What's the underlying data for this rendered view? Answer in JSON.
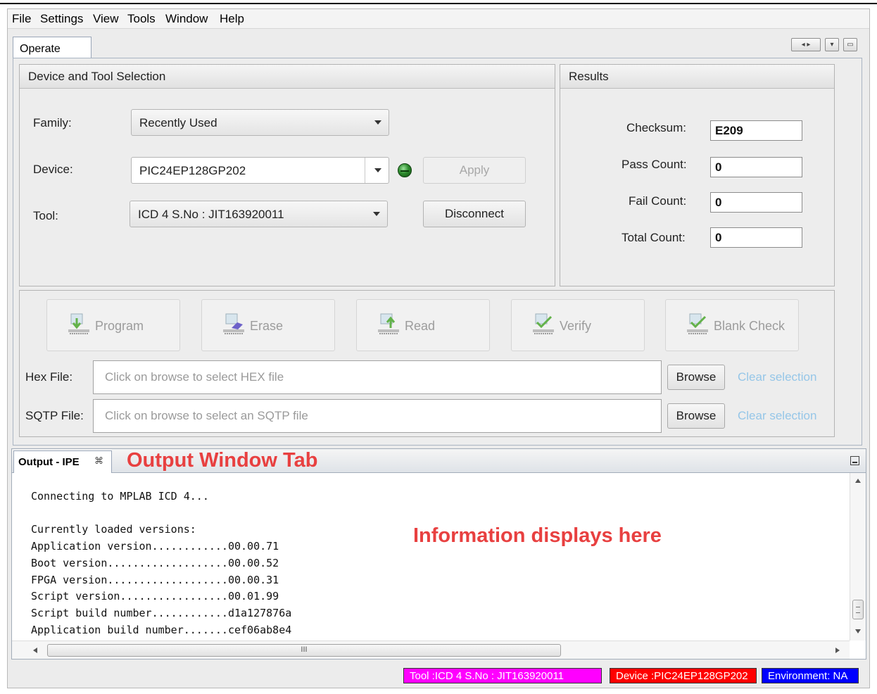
{
  "menu": [
    "File",
    "Settings",
    "View",
    "Tools",
    "Window",
    "Help"
  ],
  "tabs": {
    "operate": "Operate"
  },
  "device_tool": {
    "heading": "Device and Tool Selection",
    "family_label": "Family:",
    "family_value": "Recently Used",
    "device_label": "Device:",
    "device_value": "PIC24EP128GP202",
    "apply_label": "Apply",
    "tool_label": "Tool:",
    "tool_value": "ICD 4 S.No : JIT163920011",
    "disconnect_label": "Disconnect"
  },
  "results": {
    "heading": "Results",
    "checksum_label": "Checksum:",
    "checksum_value": "E209",
    "pass_label": "Pass Count:",
    "pass_value": "0",
    "fail_label": "Fail Count:",
    "fail_value": "0",
    "total_label": "Total Count:",
    "total_value": "0"
  },
  "actions": {
    "program": "Program",
    "erase": "Erase",
    "read": "Read",
    "verify": "Verify",
    "blank_check": "Blank Check"
  },
  "files": {
    "hex_label": "Hex File:",
    "hex_placeholder": "Click on browse to select HEX file",
    "sqtp_label": "SQTP File:",
    "sqtp_placeholder": "Click on browse to select an SQTP file",
    "browse_label": "Browse",
    "clear_label": "Clear selection"
  },
  "output": {
    "tab_label": "Output - IPE",
    "tab_close": "⌘",
    "annotation_tab": "Output Window Tab",
    "annotation_info": "Information displays here",
    "lines": [
      "Connecting to MPLAB ICD 4...",
      "",
      "Currently loaded versions:",
      "Application version............00.00.71",
      "Boot version...................00.00.52",
      "FPGA version...................00.00.31",
      "Script version.................00.01.99",
      "Script build number............d1a127876a",
      "Application build number.......cef06ab8e4"
    ],
    "hscroll_grip": "III"
  },
  "status": {
    "tool": "Tool :ICD 4 S.No : JIT163920011",
    "device": "Device :PIC24EP128GP202",
    "environment": "Environment: NA"
  },
  "colors": {
    "status_tool_bg": "#ff00ff",
    "status_device_bg": "#ff0000",
    "status_env_bg": "#0000ff",
    "annotation": "#e84040",
    "clear_link": "#95c6e8",
    "led_green": "#2d8b2d"
  },
  "icons": {
    "program": "chip-download-icon",
    "erase": "chip-erase-icon",
    "read": "chip-upload-icon",
    "verify": "chip-check-icon",
    "blank_check": "chip-check-icon",
    "led": "status-led-icon"
  }
}
